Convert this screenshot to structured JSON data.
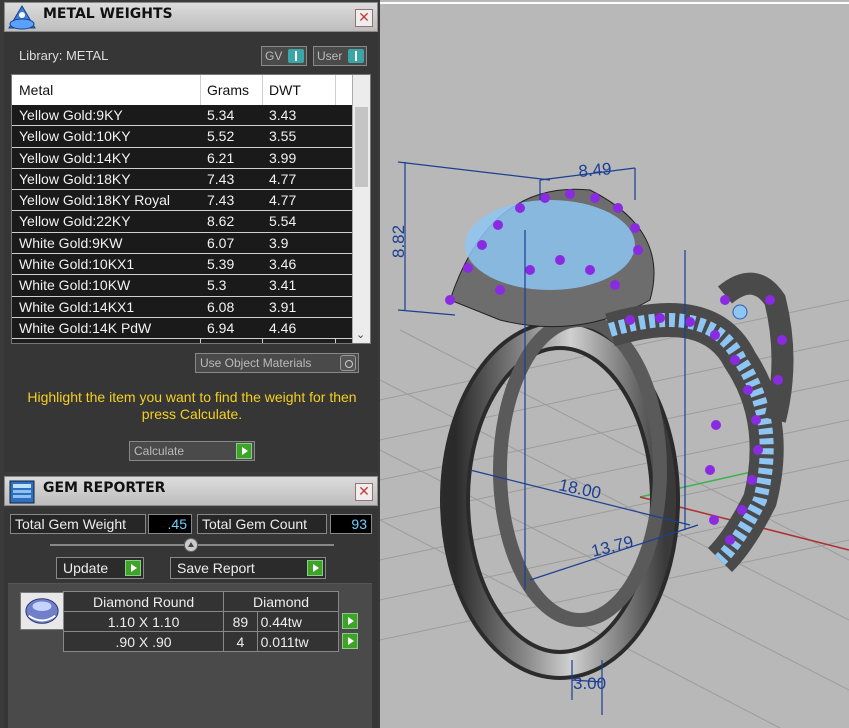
{
  "metal_weights": {
    "title": "METAL WEIGHTS",
    "close_glyph": "✕",
    "library_label": "Library: METAL",
    "toggles": [
      {
        "label": "GV"
      },
      {
        "label": "User"
      }
    ],
    "columns": [
      "Metal",
      "Grams",
      "DWT"
    ],
    "rows": [
      {
        "metal": "Yellow Gold:9KY",
        "grams": "5.34",
        "dwt": "3.43"
      },
      {
        "metal": "Yellow Gold:10KY",
        "grams": "5.52",
        "dwt": "3.55"
      },
      {
        "metal": "Yellow Gold:14KY",
        "grams": "6.21",
        "dwt": "3.99"
      },
      {
        "metal": "Yellow Gold:18KY",
        "grams": "7.43",
        "dwt": "4.77"
      },
      {
        "metal": "Yellow Gold:18KY Royal",
        "grams": "7.43",
        "dwt": "4.77"
      },
      {
        "metal": "Yellow Gold:22KY",
        "grams": "8.62",
        "dwt": "5.54"
      },
      {
        "metal": "White Gold:9KW",
        "grams": "6.07",
        "dwt": "3.9"
      },
      {
        "metal": "White Gold:10KX1",
        "grams": "5.39",
        "dwt": "3.46"
      },
      {
        "metal": "White Gold:10KW",
        "grams": "5.3",
        "dwt": "3.41"
      },
      {
        "metal": "White Gold:14KX1",
        "grams": "6.08",
        "dwt": "3.91"
      },
      {
        "metal": "White Gold:14K PdW",
        "grams": "6.94",
        "dwt": "4.46"
      }
    ],
    "use_object_materials": "Use Object Materials",
    "hint": "Highlight the item you want to find the weight for then press Calculate.",
    "calculate_label": "Calculate"
  },
  "gem_reporter": {
    "title": "GEM REPORTER",
    "close_glyph": "✕",
    "total_gem_weight_label": "Total Gem Weight",
    "total_gem_weight": ".45",
    "total_gem_count_label": "Total Gem Count",
    "total_gem_count": "93",
    "update_label": "Update",
    "save_report_label": "Save Report",
    "table": {
      "header": [
        "Diamond Round",
        "Diamond"
      ],
      "rows": [
        {
          "size": "1.10 X 1.10",
          "count": "89",
          "weight": "0.44tw"
        },
        {
          "size": ".90 X .90",
          "count": "4",
          "weight": "0.011tw"
        }
      ]
    }
  },
  "viewport": {
    "dimensions": [
      "8.49",
      "8.82",
      "18.00",
      "13.79",
      "3.00"
    ]
  },
  "colors": {
    "panel_bg": "#363636",
    "hint_text": "#f4d020",
    "gem_value_text": "#6fd0ff",
    "viewport_bg": "#b8b8b8",
    "dimension_line": "#1c3f92",
    "prong": "#8a2be2",
    "stone": "#8ec5f2",
    "arrow_button": "#3fa32a"
  }
}
